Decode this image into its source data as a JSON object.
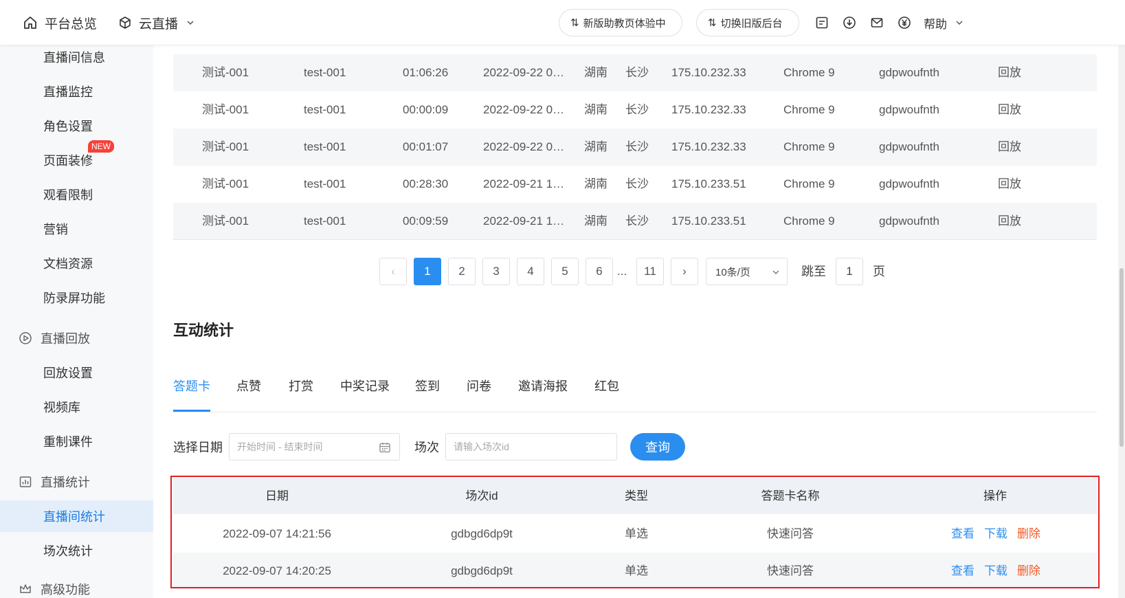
{
  "header": {
    "home_label": "平台总览",
    "product_label": "云直播",
    "pill_new": "新版助教页体验中",
    "pill_old": "切换旧版后台",
    "help_label": "帮助"
  },
  "sidebar": {
    "items": [
      {
        "label": "直播间信息"
      },
      {
        "label": "直播监控"
      },
      {
        "label": "角色设置"
      },
      {
        "label": "页面装修"
      },
      {
        "label": "观看限制"
      },
      {
        "label": "营销"
      },
      {
        "label": "文档资源"
      },
      {
        "label": "防录屏功能"
      }
    ],
    "new_badge": "NEW",
    "group_replay": "直播回放",
    "replay_items": [
      {
        "label": "回放设置"
      },
      {
        "label": "视频库"
      },
      {
        "label": "重制课件"
      }
    ],
    "group_stats": "直播统计",
    "stats_items": [
      {
        "label": "直播间统计"
      },
      {
        "label": "场次统计"
      }
    ],
    "group_advanced": "高级功能"
  },
  "viewer_table": {
    "rows": [
      {
        "name": "测试-001",
        "id": "test-001",
        "duration": "01:06:26",
        "time": "2022-09-22 0…",
        "province": "湖南",
        "city": "长沙",
        "ip": "175.10.232.33",
        "browser": "Chrome 9",
        "user": "gdpwoufnth",
        "action": "回放"
      },
      {
        "name": "测试-001",
        "id": "test-001",
        "duration": "00:00:09",
        "time": "2022-09-22 0…",
        "province": "湖南",
        "city": "长沙",
        "ip": "175.10.232.33",
        "browser": "Chrome 9",
        "user": "gdpwoufnth",
        "action": "回放"
      },
      {
        "name": "测试-001",
        "id": "test-001",
        "duration": "00:01:07",
        "time": "2022-09-22 0…",
        "province": "湖南",
        "city": "长沙",
        "ip": "175.10.232.33",
        "browser": "Chrome 9",
        "user": "gdpwoufnth",
        "action": "回放"
      },
      {
        "name": "测试-001",
        "id": "test-001",
        "duration": "00:28:30",
        "time": "2022-09-21 1…",
        "province": "湖南",
        "city": "长沙",
        "ip": "175.10.233.51",
        "browser": "Chrome 9",
        "user": "gdpwoufnth",
        "action": "回放"
      },
      {
        "name": "测试-001",
        "id": "test-001",
        "duration": "00:09:59",
        "time": "2022-09-21 1…",
        "province": "湖南",
        "city": "长沙",
        "ip": "175.10.233.51",
        "browser": "Chrome 9",
        "user": "gdpwoufnth",
        "action": "回放"
      }
    ]
  },
  "pagination": {
    "prev": "‹",
    "pages": [
      "1",
      "2",
      "3",
      "4",
      "5",
      "6"
    ],
    "ellipsis": "...",
    "last": "11",
    "next": "›",
    "page_size": "10条/页",
    "jump_label": "跳至",
    "jump_value": "1",
    "page_suffix": "页"
  },
  "interaction": {
    "title": "互动统计",
    "tabs": [
      "答题卡",
      "点赞",
      "打赏",
      "中奖记录",
      "签到",
      "问卷",
      "邀请海报",
      "红包"
    ],
    "filter": {
      "date_label": "选择日期",
      "date_placeholder": "开始时间 - 结束时间",
      "session_label": "场次",
      "session_placeholder": "请输入场次id",
      "query_button": "查询"
    },
    "table": {
      "headers": [
        "日期",
        "场次id",
        "类型",
        "答题卡名称",
        "操作"
      ],
      "rows": [
        {
          "date": "2022-09-07 14:21:56",
          "session": "gdbgd6dp9t",
          "type": "单选",
          "name": "快速问答"
        },
        {
          "date": "2022-09-07 14:20:25",
          "session": "gdbgd6dp9t",
          "type": "单选",
          "name": "快速问答"
        }
      ],
      "actions": {
        "view": "查看",
        "download": "下载",
        "delete": "删除"
      }
    }
  }
}
